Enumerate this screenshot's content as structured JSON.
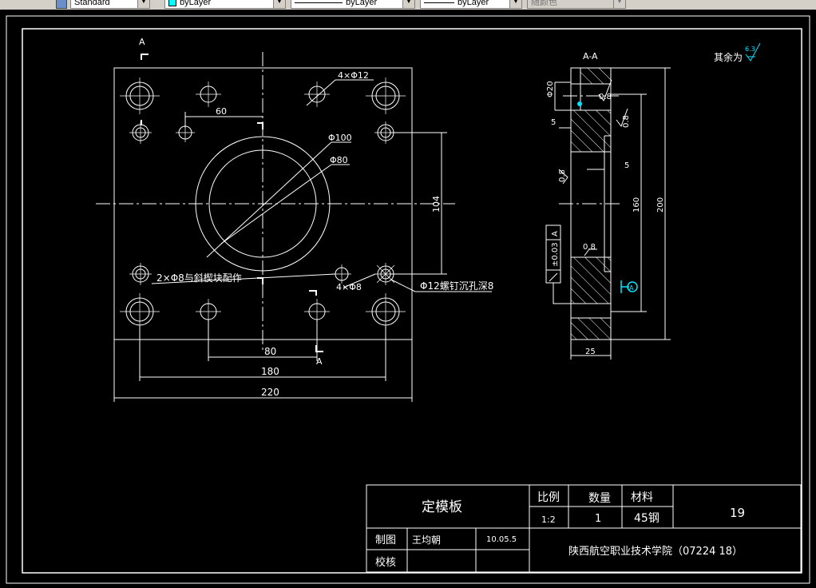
{
  "toolbar": {
    "text_style": "Standard",
    "layer": "byLayer",
    "linetype": "byLayer",
    "lineweight": "byLayer",
    "color": "随颜色"
  },
  "drawing": {
    "section_marker": "A",
    "section_title": "A-A",
    "roughness_note": "其余为",
    "roughness_value": "6.3",
    "front_view": {
      "dim_holes_12": "4×Φ12",
      "dim_60": "60",
      "dim_100": "Φ100",
      "dim_80": "Φ80",
      "dim_104": "104",
      "note_pin": "2×Φ8与斜楔块配作",
      "dim_holes_8": "4×Φ8",
      "note_screw": "Φ12螺钉沉孔深8",
      "dim_80_bottom": "80",
      "dim_180": "180",
      "dim_220": "220"
    },
    "side_view": {
      "dim_phi20": "Φ20",
      "rough_08": "0.8",
      "dim_5_top": "5",
      "dim_5_mid": "5",
      "dim_160": "160",
      "dim_200": "200",
      "dim_25": "25",
      "tolerance": "±0.03",
      "datum": "A"
    },
    "title_block": {
      "part_name": "定模板",
      "scale_label": "比例",
      "scale_value": "1:2",
      "quantity_label": "数量",
      "quantity_value": "1",
      "material_label": "材料",
      "material_value": "45钢",
      "drawing_no": "19",
      "drawn_label": "制图",
      "drawn_by": "王均朝",
      "date": "10.05.5",
      "checked_label": "校核",
      "institution": "陕西航空职业技术学院（07224 18）"
    }
  }
}
